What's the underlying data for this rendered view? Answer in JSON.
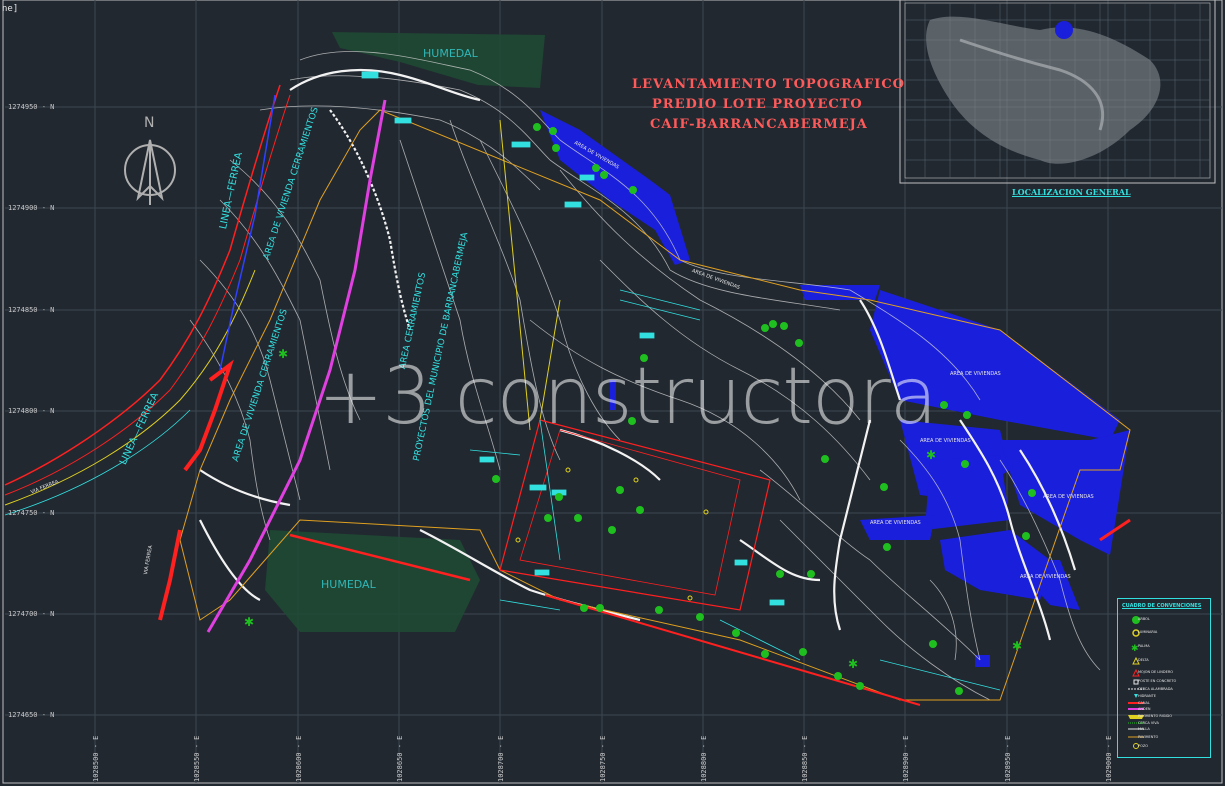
{
  "window_tag": "ne]",
  "title": {
    "line1": "LEVANTAMIENTO  TOPOGRAFICO",
    "line2": "PREDIO  LOTE  PROYECTO",
    "line3": "CAIF-BARRANCABERMEJA"
  },
  "inset_title": "LOCALIZACION  GENERAL",
  "north_label": "N",
  "watermark": "+3 constructora",
  "northings": [
    "1274950 - N",
    "1274900 - N",
    "1274850 - N",
    "1274800 - N",
    "1274750 - N",
    "1274700 - N",
    "1274650 - N"
  ],
  "eastings": [
    "1028500 - E",
    "1028550 - E",
    "1028600 - E",
    "1028650 - E",
    "1028700 - E",
    "1028750 - E",
    "1028800 - E",
    "1028850 - E",
    "1028900 - E",
    "1028950 - E",
    "1029000 - E",
    "1029050 - E"
  ],
  "area_labels": {
    "humedal_top": "HUMEDAL",
    "humedal_bottom": "HUMEDAL",
    "linea_ferrea_1": "LINEA—FERREA",
    "linea_ferrea_2": "LINEA—FERREA",
    "via_ferrea": "VIA FERREA",
    "via_ferrea_2": "VIA FERREA",
    "vivienda_1": "AREA DE VIVIENDA CERRAMIENTOS",
    "vivienda_2": "AREA DE VIVIENDA CERRAMIENTOS",
    "cerramientos_1": "AREA CERRAMIENTOS",
    "proyectos": "PROYECTOS DEL MUNICIPIO DE BARRANCABERMEJA",
    "viviendas_a": "AREA DE VIVIENDAS",
    "viviendas_b": "AREA DE VIVIENDAS",
    "viviendas_c": "AREA DE VIVIENDAS",
    "viviendas_d": "AREA DE VIVIENDAS",
    "viviendas_e": "AREA DE VIVIENDAS",
    "viviendas_f": "AREA DE VIVIENDAS",
    "viviendas_g": "AREA DE VIVIENDAS"
  },
  "legend": {
    "title": "CUADRO DE CONVENCIONES",
    "items": [
      "ARBOL",
      "LUMINARIA",
      "PALMA",
      "DELTA",
      "MOJON DE LINDERO",
      "POSTE EN CONCRETO",
      "CERCA ALAMBRADA",
      "HIDRANTE",
      "CANAL",
      "ANDEN",
      "PAVIMENTO RIGIDO",
      "CERCA VIVA",
      "MALLA",
      "PAVIMENTO",
      "POZO"
    ]
  },
  "colors": {
    "background": "#212830",
    "grid": "#3d4650",
    "contour": "#d9d9d9",
    "water": "#1a1fdc",
    "humedal": "#1e4a34",
    "tree": "#1fbf1f",
    "title": "#ff5a5a",
    "cyan": "#33e0e0",
    "magenta": "#e040e0",
    "red": "#ff2020",
    "yellow": "#e0d020"
  }
}
